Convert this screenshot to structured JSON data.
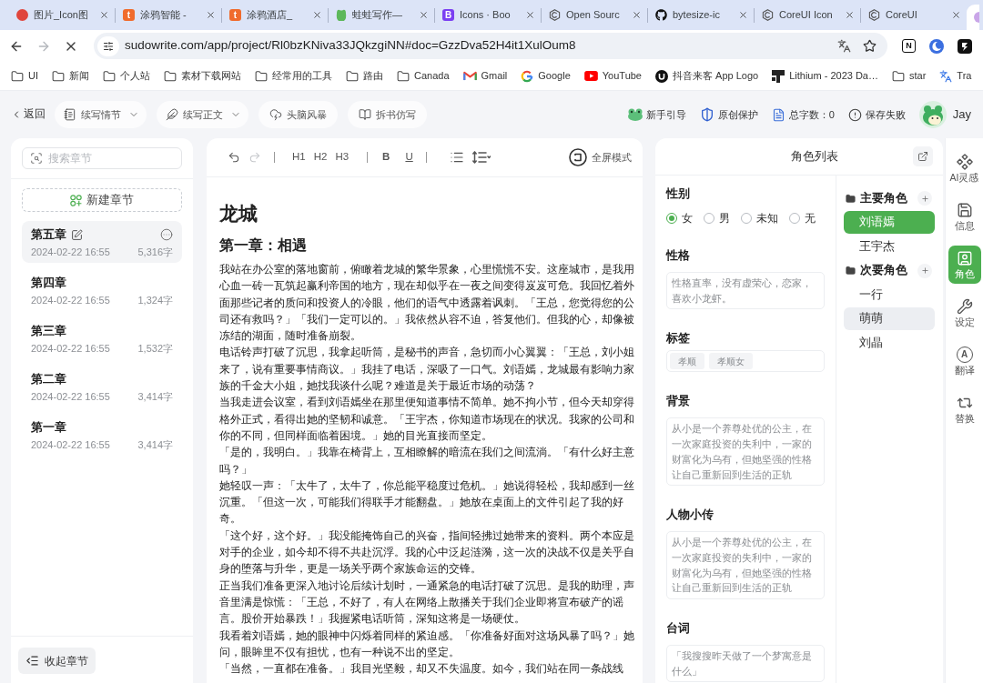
{
  "browser": {
    "tabs": [
      {
        "title": "图片_Icon图",
        "favicon": {
          "kind": "blob"
        },
        "selected": false
      },
      {
        "title": "涂鸦智能 -",
        "favicon": {
          "kind": "badge",
          "glyph": "t",
          "color": "#f06b2d"
        },
        "selected": false
      },
      {
        "title": "涂鸦酒店_",
        "favicon": {
          "kind": "badge",
          "glyph": "t",
          "color": "#f06b2d"
        },
        "selected": false
      },
      {
        "title": "蛙蛙写作—",
        "favicon": {
          "kind": "frog"
        },
        "selected": false
      },
      {
        "title": "Icons · Boo",
        "favicon": {
          "kind": "badge",
          "glyph": "B",
          "color": "#7b3ff2"
        },
        "selected": false
      },
      {
        "title": "Open Sourc",
        "favicon": {
          "kind": "hexagon"
        },
        "selected": false
      },
      {
        "title": "bytesize-ic",
        "favicon": {
          "kind": "cat"
        },
        "selected": false
      },
      {
        "title": "CoreUI Icon",
        "favicon": {
          "kind": "hexagon"
        },
        "selected": false
      },
      {
        "title": "CoreUI",
        "favicon": {
          "kind": "hexagon"
        },
        "selected": false
      },
      {
        "favicon": {
          "kind": "orb"
        },
        "selected": true
      }
    ],
    "nav": [
      {
        "kind": "back",
        "disabled": false
      },
      {
        "kind": "forward",
        "disabled": true
      },
      {
        "kind": "stop",
        "disabled": false
      }
    ],
    "url": "sudowrite.com/app/project/Rl0bzKNiva33JQkzgiNN#doc=GzzDva52H4it1XulOum8",
    "extensions": [
      {
        "kind": "letter",
        "glyph": "N"
      },
      {
        "kind": "moon"
      },
      {
        "kind": "bolt"
      }
    ],
    "bookmarks": [
      {
        "label": "UI",
        "kind": "folder"
      },
      {
        "label": "新闻",
        "kind": "folder"
      },
      {
        "label": "个人站",
        "kind": "folder"
      },
      {
        "label": "素材下载网站",
        "kind": "folder"
      },
      {
        "label": "经常用的工具",
        "kind": "folder"
      },
      {
        "label": "路由",
        "kind": "folder"
      },
      {
        "label": "Canada",
        "kind": "folder"
      },
      {
        "label": "Gmail",
        "kind": "mail"
      },
      {
        "label": "Google",
        "kind": "ring"
      },
      {
        "label": "YouTube",
        "kind": "video"
      },
      {
        "label": "抖音来客 App Logo",
        "kind": "disc"
      },
      {
        "label": "Lithium - 2023 Da…",
        "kind": "block"
      },
      {
        "label": "star",
        "kind": "folder"
      },
      {
        "label": "Tra",
        "kind": "translate"
      }
    ]
  },
  "toolbar": {
    "back": "返回",
    "actions": [
      {
        "label": "续写情节",
        "kind": "plot",
        "dropdown": true
      },
      {
        "label": "续写正文",
        "kind": "prose",
        "dropdown": true
      },
      {
        "label": "头脑风暴",
        "kind": "brainstorm",
        "dropdown": false
      },
      {
        "label": "拆书仿写",
        "kind": "imitate",
        "dropdown": false
      }
    ],
    "status": [
      {
        "label": "新手引导",
        "kind": "guide"
      },
      {
        "label": "原创保护",
        "kind": "shield"
      },
      {
        "label": "总字数：0",
        "kind": "count"
      },
      {
        "label": "保存失败",
        "kind": "error"
      }
    ],
    "user": "Jay"
  },
  "chapters": {
    "search_placeholder": "搜索章节",
    "new_chapter": "新建章节",
    "items": [
      {
        "title": "第五章",
        "date": "2024-02-22 16:55",
        "words": "5,316字",
        "selected": true
      },
      {
        "title": "第四章",
        "date": "2024-02-22 16:55",
        "words": "1,324字",
        "selected": false
      },
      {
        "title": "第三章",
        "date": "2024-02-22 16:55",
        "words": "1,532字",
        "selected": false
      },
      {
        "title": "第二章",
        "date": "2024-02-22 16:55",
        "words": "3,414字",
        "selected": false
      },
      {
        "title": "第一章",
        "date": "2024-02-22 16:55",
        "words": "3,414字",
        "selected": false
      }
    ],
    "collapse": "收起章节"
  },
  "editor": {
    "history": [
      {
        "kind": "undo",
        "disabled": false
      },
      {
        "kind": "redo",
        "disabled": true
      }
    ],
    "headings": [
      "H1",
      "H2",
      "H3"
    ],
    "marks": [
      {
        "kind": "bold",
        "label": "B"
      },
      {
        "kind": "underline",
        "label": "U"
      }
    ],
    "fullscreen": "全屏模式",
    "title": "龙城",
    "heading": "第一章：相遇",
    "paragraphs": [
      "我站在办公室的落地窗前，俯瞰着龙城的繁华景象，心里慌慌不安。这座城市，是我用心血一砖一瓦筑起赢利帝国的地方，现在却似乎在一夜之间变得岌岌可危。我回忆着外面那些记者的质问和投资人的冷眼，他们的语气中透露着讽刺。「王总，您觉得您的公司还有救吗？」「我们一定可以的。」我依然从容不迫，答复他们。但我的心，却像被冻结的湖面，随时准备崩裂。",
      "电话铃声打破了沉思，我拿起听筒，是秘书的声音，急切而小心翼翼：「王总，刘小姐来了，说有重要事情商议。」我挂了电话，深吸了一口气。刘语嫣，龙城最有影响力家族的千金大小姐，她找我谈什么呢？难道是关于最近市场的动荡？",
      "当我走进会议室，看到刘语嫣坐在那里便知道事情不简单。她不拘小节，但今天却穿得格外正式，看得出她的坚韧和诚意。「王宇杰，你知道市场现在的状况。我家的公司和你的不同，但同样面临着困境。」她的目光直接而坚定。",
      "「是的，我明白。」我靠在椅背上，互相瞭解的暗流在我们之间流淌。「有什么好主意吗？」",
      "她轻叹一声：「太牛了，太牛了，你总能平稳度过危机。」她说得轻松，我却感到一丝沉重。「但这一次，可能我们得联手才能翻盘。」她放在桌面上的文件引起了我的好奇。",
      "「这个好，这个好。」我没能掩饰自己的兴奋，指间轻拂过她带来的资料。两个本应是对手的企业，如今却不得不共赴沉浮。我的心中泛起涟漪，这一次的决战不仅是关乎自身的堕落与升华，更是一场关乎两个家族命运的交锋。",
      "正当我们准备更深入地讨论后续计划时，一通紧急的电话打破了沉思。是我的助理，声音里满是惊慌：「王总，不好了，有人在网络上散播关于我们企业即将宣布破产的谣言。股价开始暴跌！」我握紧电话听筒，深知这将是一场硬仗。",
      "我看着刘语嫣，她的眼神中闪烁着同样的紧迫感。「你准备好面对这场风暴了吗？」她问，眼眸里不仅有担忧，也有一种说不出的坚定。",
      "「当然，一直都在准备。」我目光坚毅，却又不失温度。如今，我们站在同一条战线"
    ]
  },
  "characters": {
    "title": "角色列表",
    "fields": [
      {
        "kind": "radio",
        "label": "性别",
        "options": [
          {
            "label": "女",
            "selected": true
          },
          {
            "label": "男",
            "selected": false
          },
          {
            "label": "未知",
            "selected": false
          },
          {
            "label": "无",
            "selected": false
          }
        ]
      },
      {
        "kind": "text",
        "label": "性格",
        "value": "性格直率，没有虚荣心，恋家，喜欢小龙虾。"
      },
      {
        "kind": "tags",
        "label": "标签",
        "tags": [
          "孝顺",
          "孝顺女"
        ]
      },
      {
        "kind": "text",
        "label": "背景",
        "value": "从小是一个养尊处优的公主，在一次家庭投资的失利中，一家的财富化为乌有，但她坚强的性格让自己重新回到生活的正轨"
      },
      {
        "kind": "text",
        "label": "人物小传",
        "value": "从小是一个养尊处优的公主，在一次家庭投资的失利中，一家的财富化为乌有，但她坚强的性格让自己重新回到生活的正轨"
      },
      {
        "kind": "text",
        "label": "台词",
        "value": "「我搜搜昨天做了一个梦寓意是什么」"
      }
    ],
    "groups": [
      {
        "name": "主要角色",
        "members": [
          {
            "name": "刘语嫣",
            "selected": true,
            "hovered": false
          },
          {
            "name": "王宇杰",
            "selected": false,
            "hovered": false
          }
        ]
      },
      {
        "name": "次要角色",
        "members": [
          {
            "name": "一行",
            "selected": false,
            "hovered": false
          },
          {
            "name": "萌萌",
            "selected": false,
            "hovered": true
          },
          {
            "name": "刘晶",
            "selected": false,
            "hovered": false
          }
        ]
      }
    ]
  },
  "rail": [
    {
      "label": "AI灵感",
      "kind": "spark",
      "selected": false
    },
    {
      "label": "信息",
      "kind": "info",
      "selected": false
    },
    {
      "label": "角色",
      "kind": "character",
      "selected": true
    },
    {
      "label": "设定",
      "kind": "setting",
      "selected": false
    },
    {
      "label": "翻译",
      "kind": "translate",
      "glyph": "A",
      "selected": false
    },
    {
      "label": "替换",
      "kind": "replace",
      "selected": false
    }
  ]
}
